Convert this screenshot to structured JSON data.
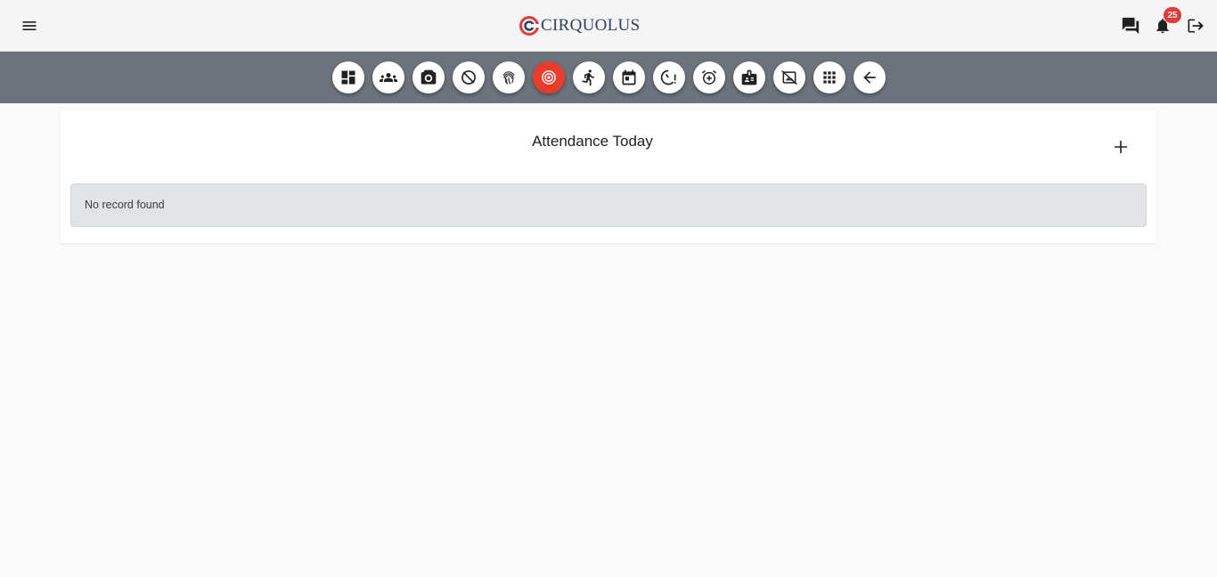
{
  "header": {
    "menu_icon": "hamburger-menu-icon",
    "logo_text": "CIRQUOLUS",
    "logo_colors": {
      "ring": "#e53935",
      "text": "#2f3e6b"
    },
    "chat_icon": "chat-bubbles-icon",
    "notification_icon": "bell-icon",
    "notification_count": "25",
    "logout_icon": "logout-icon"
  },
  "toolbar": {
    "background": "#6c737c",
    "active_color": "#ea3b2b",
    "items": [
      {
        "icon": "dashboard-icon"
      },
      {
        "icon": "group-icon"
      },
      {
        "icon": "camera-icon"
      },
      {
        "icon": "disabled-timer-icon"
      },
      {
        "icon": "fingerprint-icon"
      },
      {
        "icon": "target-icon",
        "active": true
      },
      {
        "icon": "running-person-icon"
      },
      {
        "icon": "calendar-icon"
      },
      {
        "icon": "timer-alert-icon"
      },
      {
        "icon": "alarm-add-icon"
      },
      {
        "icon": "id-badge-icon"
      },
      {
        "icon": "image-off-icon"
      },
      {
        "icon": "apps-grid-icon"
      },
      {
        "icon": "arrow-back-icon"
      }
    ]
  },
  "main": {
    "title": "Attendance Today",
    "add_icon": "plus-icon",
    "empty_message": "No record found"
  }
}
